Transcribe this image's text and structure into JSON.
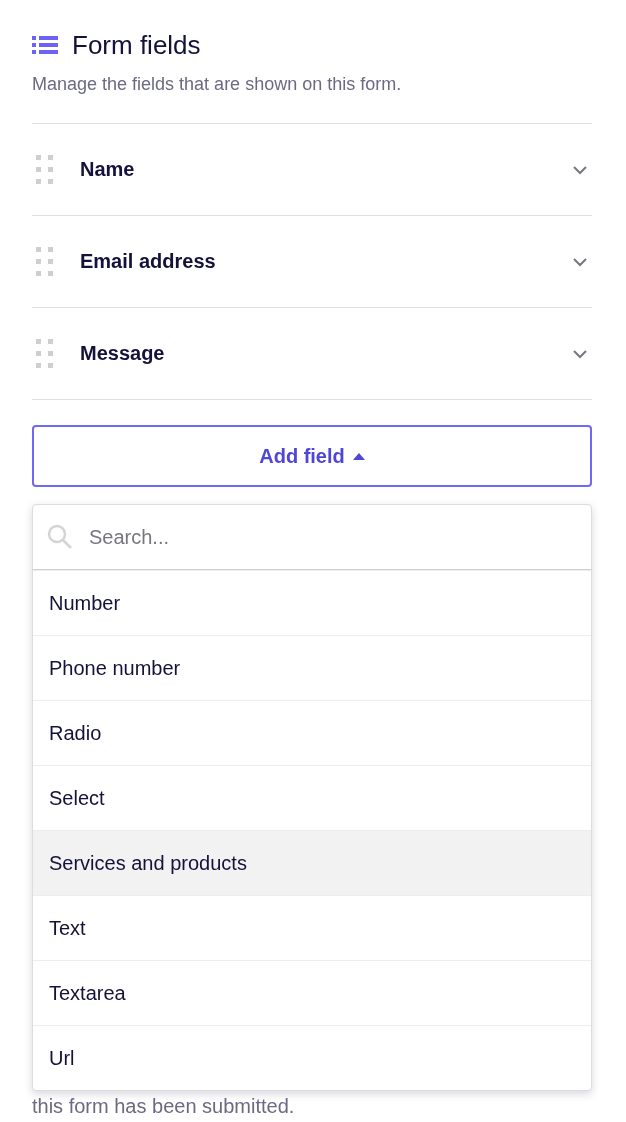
{
  "header": {
    "title": "Form fields",
    "subtitle": "Manage the fields that are shown on this form."
  },
  "fields": [
    {
      "label": "Name",
      "expanded": false
    },
    {
      "label": "Email address",
      "expanded": false
    },
    {
      "label": "Message",
      "expanded": false
    }
  ],
  "add_button": {
    "label": "Add field",
    "open": true
  },
  "menu": {
    "search_placeholder": "Search...",
    "items": [
      {
        "label": "Number",
        "selected": false
      },
      {
        "label": "Phone number",
        "selected": false
      },
      {
        "label": "Radio",
        "selected": false
      },
      {
        "label": "Select",
        "selected": false
      },
      {
        "label": "Services and products",
        "selected": true
      },
      {
        "label": "Text",
        "selected": false
      },
      {
        "label": "Textarea",
        "selected": false
      },
      {
        "label": "Url",
        "selected": false
      }
    ]
  },
  "footer_note": "this form has been submitted."
}
